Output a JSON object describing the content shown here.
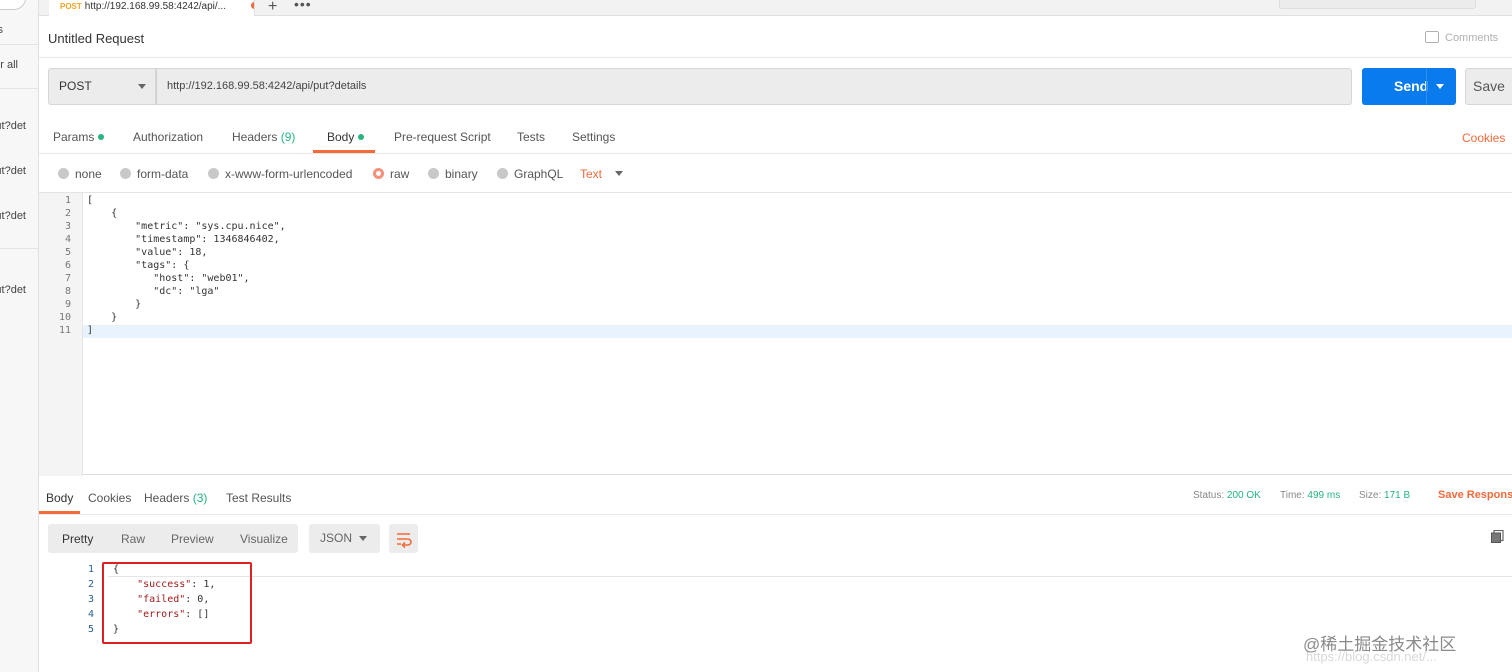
{
  "sidebar": {
    "fragments": [
      "s",
      "r all",
      "ut?det",
      "ut?det",
      "ut?det",
      "ut?det"
    ]
  },
  "tab": {
    "method": "POST",
    "url": "http://192.168.99.58:4242/api/...",
    "unsaved_dot_color": "#f26b3a",
    "new_tab_icon": "plus-icon",
    "more_icon": "ellipsis-icon"
  },
  "request": {
    "title": "Untitled Request",
    "comments_label": "Comments",
    "comments_icon": "comment-icon",
    "method": "POST",
    "url": "http://192.168.99.58:4242/api/put?details",
    "send_label": "Send",
    "save_label": "Save",
    "send_color": "#097bed"
  },
  "request_tabs": {
    "params": "Params",
    "authorization": "Authorization",
    "headers": "Headers",
    "headers_count": "(9)",
    "body": "Body",
    "prerequest": "Pre-request Script",
    "tests": "Tests",
    "settings": "Settings",
    "cookies": "Cookies",
    "active": "Body"
  },
  "body_types": {
    "none": "none",
    "form_data": "form-data",
    "urlencoded": "x-www-form-urlencoded",
    "raw": "raw",
    "binary": "binary",
    "graphql": "GraphQL",
    "selected": "raw",
    "raw_format": "Text"
  },
  "request_body": {
    "lines": [
      "[",
      "    {",
      "        \"metric\": \"sys.cpu.nice\",",
      "        \"timestamp\": 1346846402,",
      "        \"value\": 18,",
      "        \"tags\": {",
      "           \"host\": \"web01\",",
      "           \"dc\": \"lga\"",
      "        }",
      "    }",
      "]"
    ],
    "line_numbers": [
      "1",
      "2",
      "3",
      "4",
      "5",
      "6",
      "7",
      "8",
      "9",
      "10",
      "11"
    ]
  },
  "response_tabs": {
    "body": "Body",
    "cookies": "Cookies",
    "headers": "Headers",
    "headers_count": "(3)",
    "test_results": "Test Results"
  },
  "response_meta": {
    "status_label": "Status:",
    "status_value": "200 OK",
    "time_label": "Time:",
    "time_value": "499 ms",
    "size_label": "Size:",
    "size_value": "171 B",
    "save_response": "Save Respons"
  },
  "response_view": {
    "pretty": "Pretty",
    "raw": "Raw",
    "preview": "Preview",
    "visualize": "Visualize",
    "format": "JSON",
    "wrap_icon": "wrap-lines-icon",
    "copy_icon": "copy-icon"
  },
  "response_body": {
    "line_numbers": [
      "1",
      "2",
      "3",
      "4",
      "5"
    ],
    "open": "{",
    "success_key": "\"success\"",
    "success_val": ": 1,",
    "failed_key": "\"failed\"",
    "failed_val": ": 0,",
    "errors_key": "\"errors\"",
    "errors_val": ": []",
    "close": "}"
  },
  "watermark": {
    "main": "@稀土掘金技术社区",
    "sub": "https://blog.csdn.net/..."
  }
}
